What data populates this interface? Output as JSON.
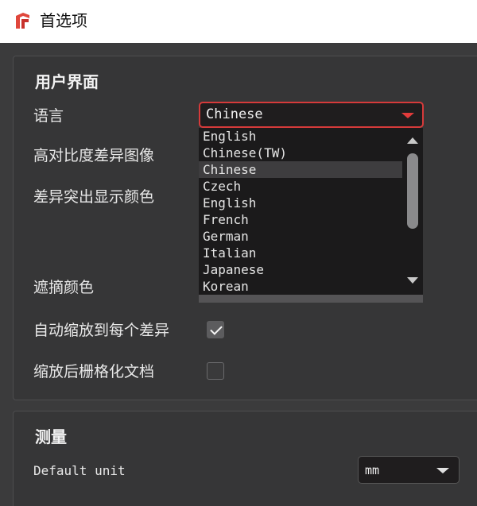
{
  "window": {
    "title": "首选项",
    "icon": "app-logo-icon"
  },
  "ui_group": {
    "title": "用户界面",
    "language_label": "语言",
    "language_value": "Chinese",
    "language_options": [
      "English",
      "Chinese(TW)",
      "Chinese",
      "Czech",
      "English",
      "French",
      "German",
      "Italian",
      "Japanese",
      "Korean"
    ],
    "language_selected_index": 2,
    "high_contrast_label": "高对比度差异图像",
    "highlight_color_label": "差异突出显示颜色",
    "mask_color_label": "遮摘颜色",
    "auto_zoom_label": "自动缩放到每个差异",
    "auto_zoom_checked": true,
    "rasterize_label": "缩放后栅格化文档",
    "rasterize_checked": false
  },
  "measure_group": {
    "title": "测量",
    "default_unit_label": "Default unit",
    "default_unit_value": "mm"
  },
  "colors": {
    "accent_red": "#d63a3a",
    "panel": "#363637",
    "background": "#3b3b3c"
  }
}
